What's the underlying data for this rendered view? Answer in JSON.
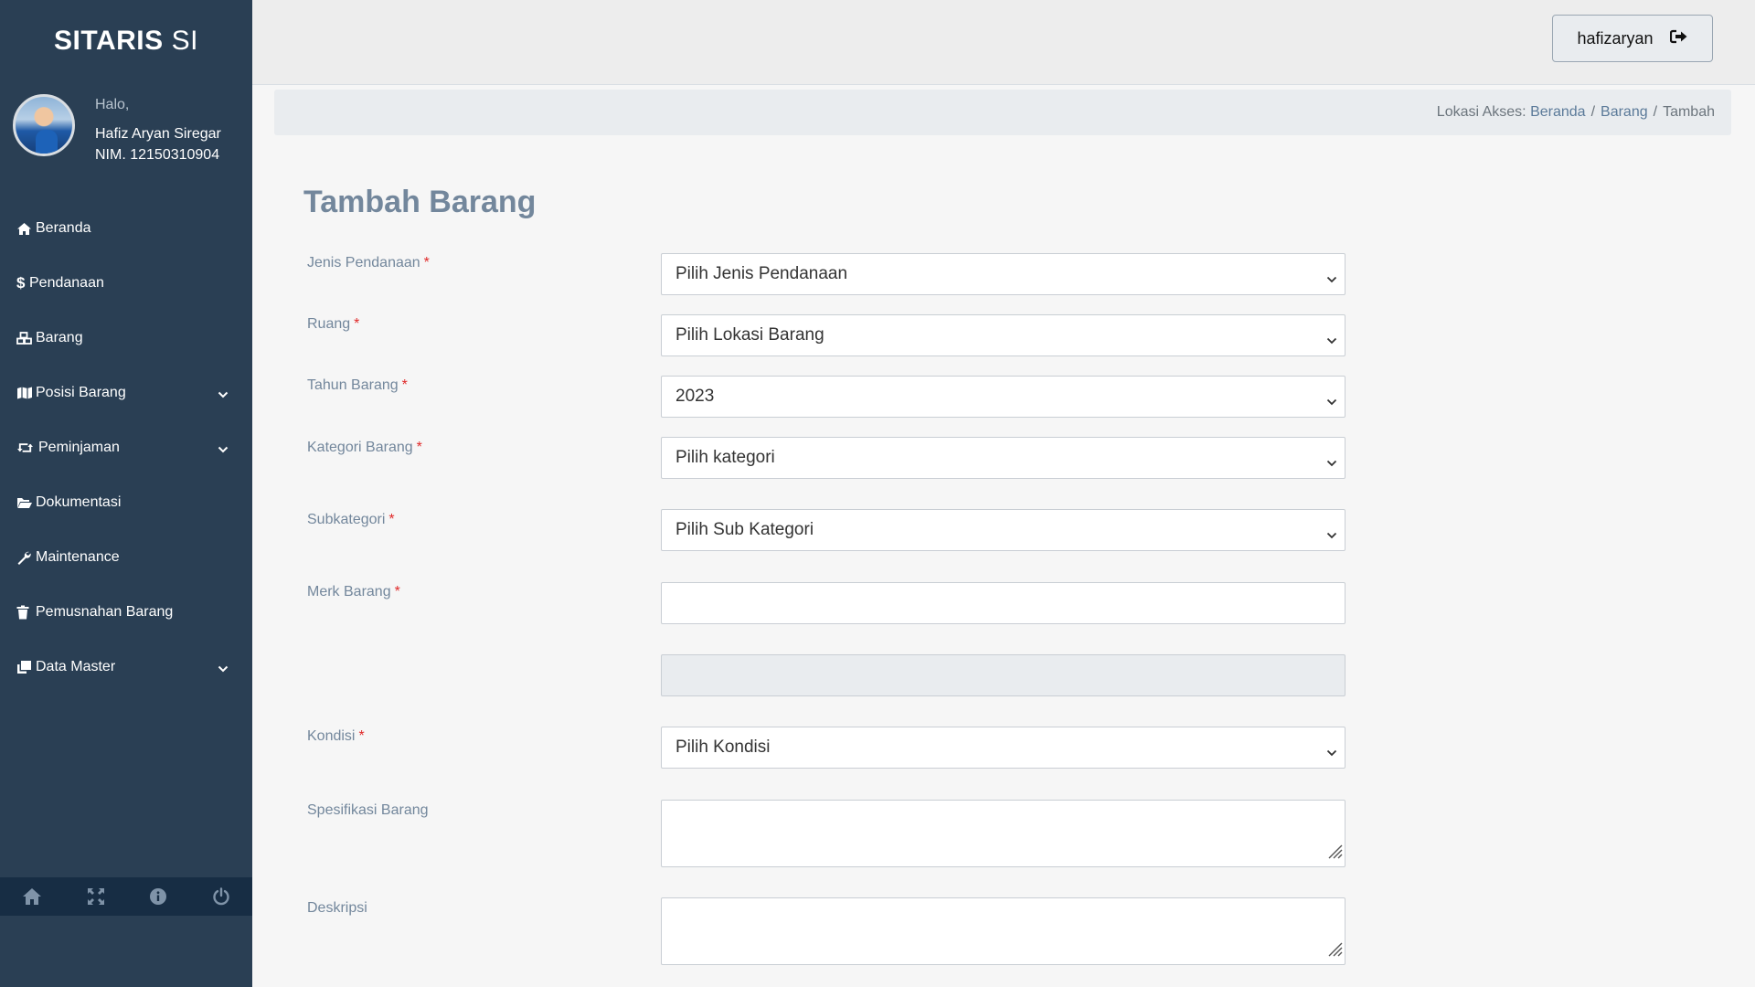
{
  "brand": {
    "bold": "SITARIS",
    "light": "SI"
  },
  "profile": {
    "greeting": "Halo,",
    "name": "Hafiz Aryan Siregar",
    "nim": "NIM. 12150310904"
  },
  "sidebar": {
    "items": [
      {
        "label": "Beranda",
        "icon": "home-icon",
        "has_submenu": false
      },
      {
        "label": "Pendanaan",
        "icon": "dollar-icon",
        "has_submenu": false
      },
      {
        "label": "Barang",
        "icon": "cubes-icon",
        "has_submenu": false
      },
      {
        "label": "Posisi Barang",
        "icon": "map-icon",
        "has_submenu": true
      },
      {
        "label": "Peminjaman",
        "icon": "retweet-icon",
        "has_submenu": true
      },
      {
        "label": "Dokumentasi",
        "icon": "folder-open-icon",
        "has_submenu": false
      },
      {
        "label": "Maintenance",
        "icon": "wrench-icon",
        "has_submenu": false
      },
      {
        "label": "Pemusnahan Barang",
        "icon": "trash-icon",
        "has_submenu": false
      },
      {
        "label": "Data Master",
        "icon": "clone-icon",
        "has_submenu": true
      }
    ],
    "footer_icons": [
      "home-icon",
      "fullscreen-icon",
      "info-icon",
      "power-icon"
    ]
  },
  "topbar": {
    "username": "hafizaryan",
    "logout_icon": "sign-out-icon"
  },
  "breadcrumb": {
    "prefix": "Lokasi Akses:",
    "items": [
      "Beranda",
      "Barang",
      "Tambah"
    ]
  },
  "form": {
    "title": "Tambah Barang",
    "required_mark": "*",
    "fields": {
      "jenis_pendanaan": {
        "label": "Jenis Pendanaan",
        "value": "Pilih Jenis Pendanaan",
        "required": true
      },
      "ruang": {
        "label": "Ruang",
        "value": "Pilih Lokasi Barang",
        "required": true
      },
      "tahun_barang": {
        "label": "Tahun Barang",
        "value": "2023",
        "required": true
      },
      "kategori_barang": {
        "label": "Kategori Barang",
        "value": "Pilih kategori",
        "required": true
      },
      "subkategori": {
        "label": "Subkategori",
        "value": "Pilih Sub Kategori",
        "required": true
      },
      "merk_barang": {
        "label": "Merk Barang",
        "value": "",
        "required": true
      },
      "extra_field": {
        "value": ""
      },
      "kondisi": {
        "label": "Kondisi",
        "value": "Pilih Kondisi",
        "required": true
      },
      "spesifikasi_barang": {
        "label": "Spesifikasi Barang",
        "value": ""
      },
      "deskripsi": {
        "label": "Deskripsi",
        "value": ""
      }
    }
  },
  "colors": {
    "sidebar": "#2a3f54",
    "sidebar_footer": "#172d44",
    "label": "#73879c",
    "required": "#e02a2a",
    "link": "#5b7a99"
  }
}
